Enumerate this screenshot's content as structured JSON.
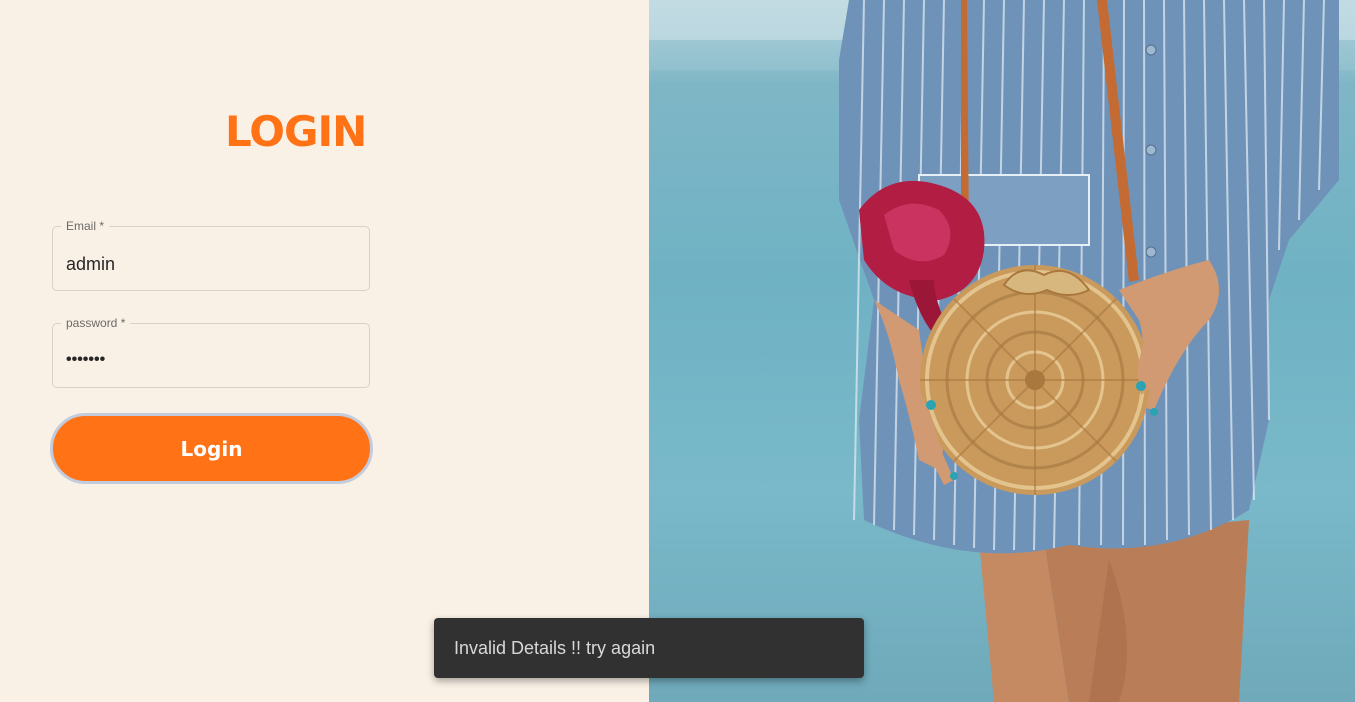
{
  "login": {
    "title": "LOGIN",
    "email_label": "Email *",
    "email_value": "admin",
    "password_label": "password *",
    "password_value": "•••••••",
    "submit_label": "Login"
  },
  "toast": {
    "message": "Invalid Details !! try again"
  },
  "colors": {
    "accent": "#ff7216",
    "panel_background": "#faf1e6",
    "toast_background": "#313131"
  },
  "hero_image": {
    "icon": "fashion-photo"
  }
}
